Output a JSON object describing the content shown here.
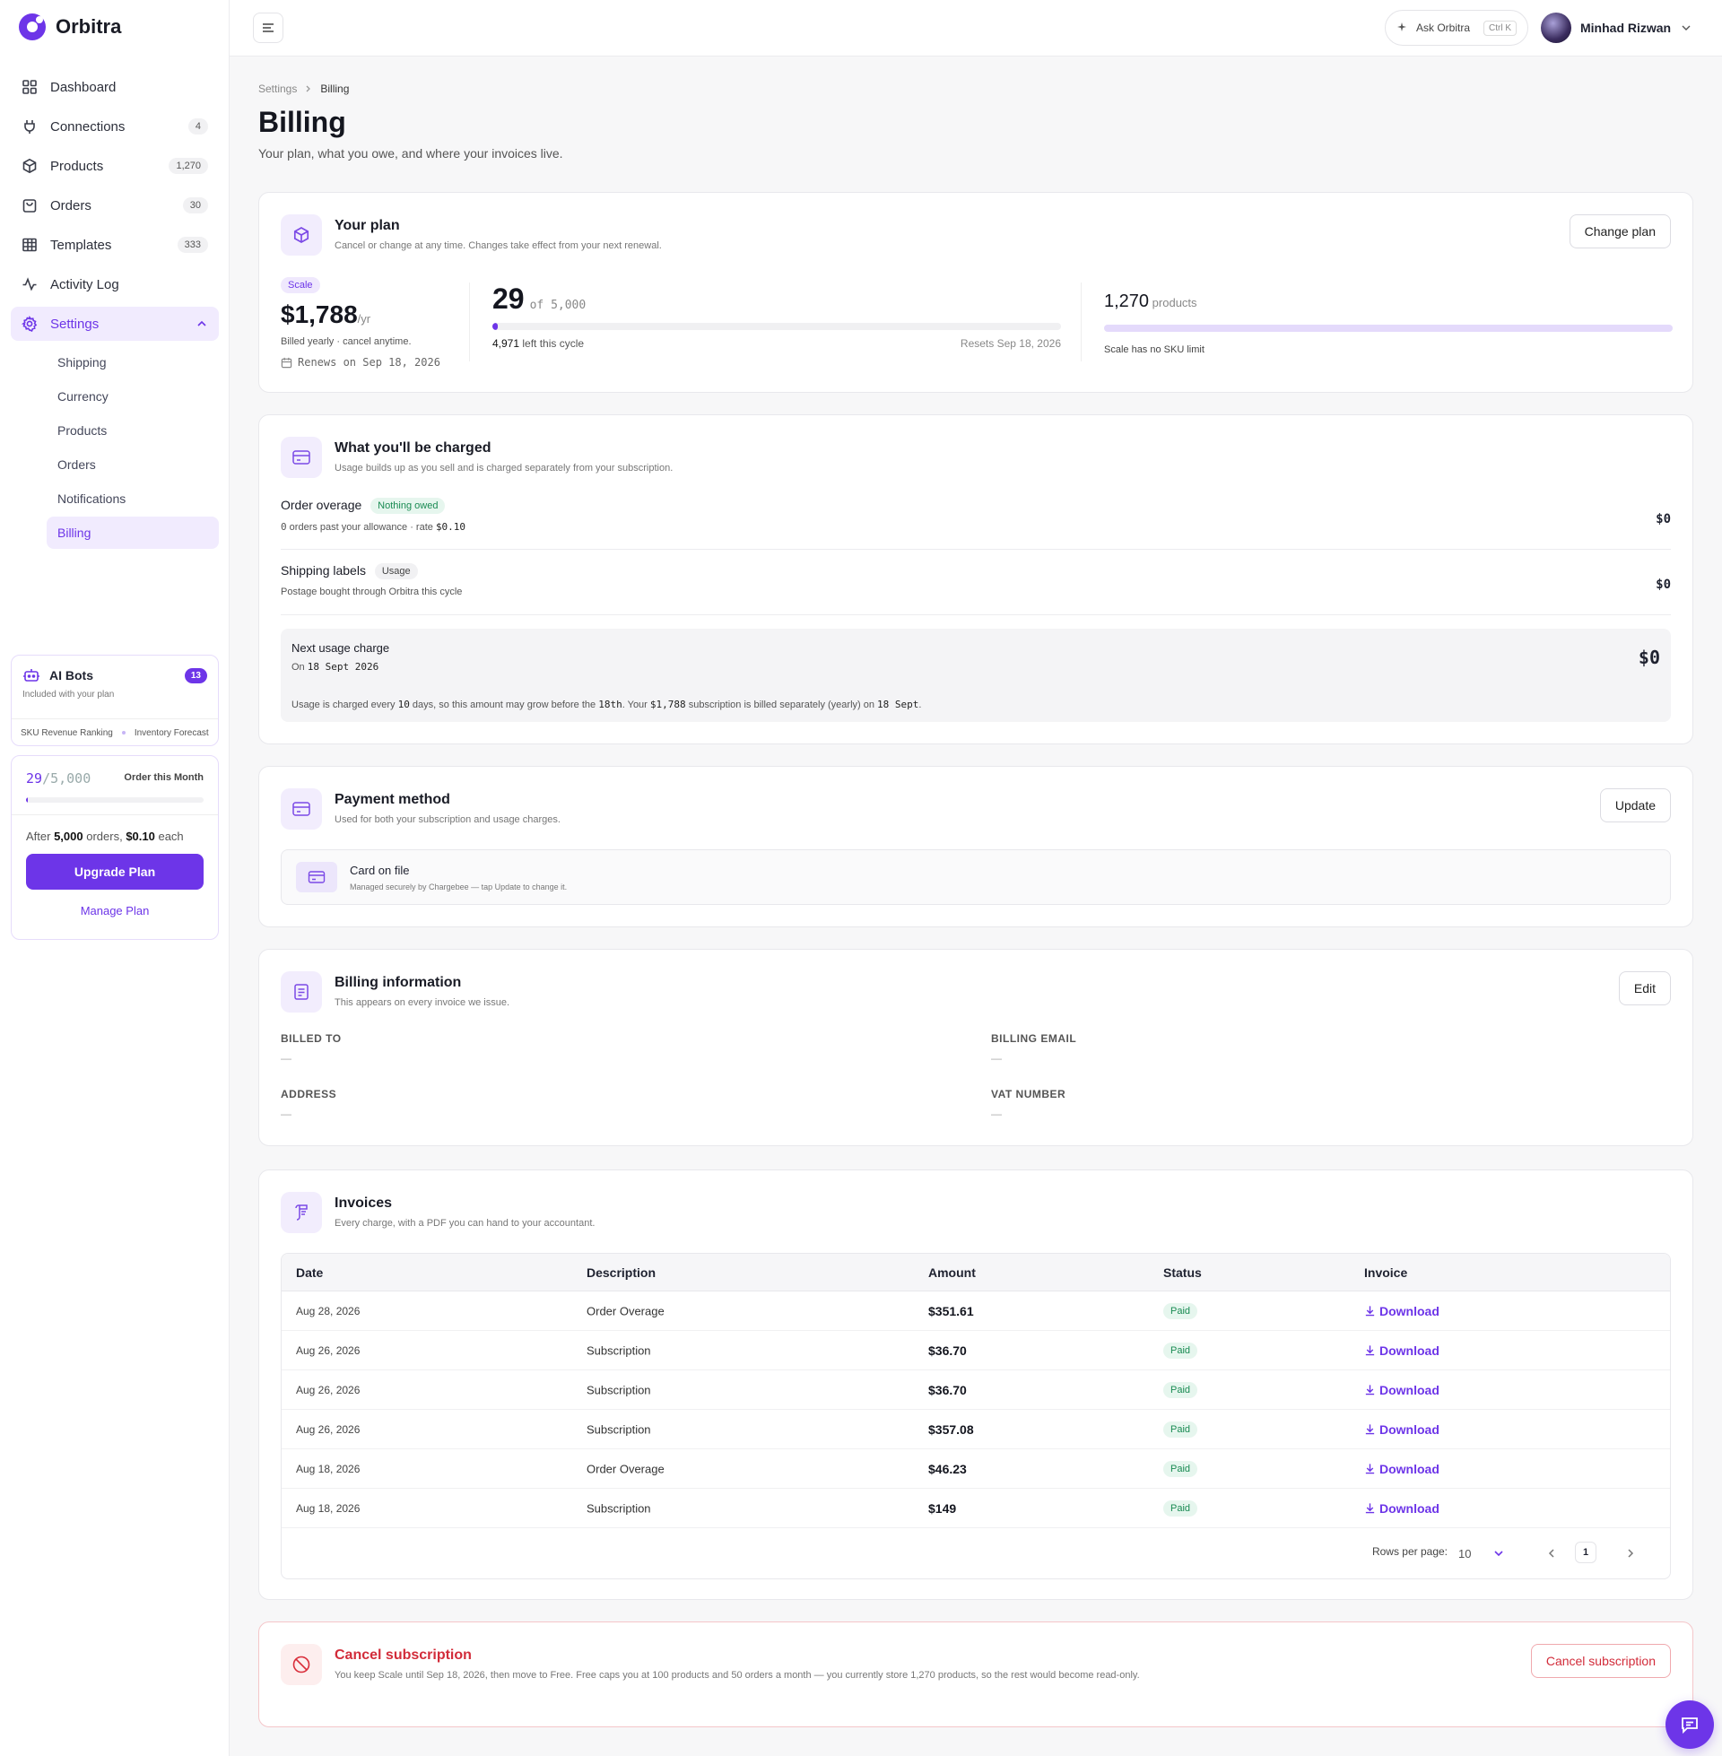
{
  "app": {
    "name": "Orbitra"
  },
  "sidebar": {
    "nav": [
      {
        "label": "Dashboard",
        "icon": "grid-icon",
        "count": ""
      },
      {
        "label": "Connections",
        "icon": "plug-icon",
        "count": "4"
      },
      {
        "label": "Products",
        "icon": "box-icon",
        "count": "1,270"
      },
      {
        "label": "Orders",
        "icon": "shopping-bag-icon",
        "count": "30"
      },
      {
        "label": "Templates",
        "icon": "table-icon",
        "count": "333"
      },
      {
        "label": "Activity Log",
        "icon": "activity-icon",
        "count": ""
      },
      {
        "label": "Settings",
        "icon": "gear-icon",
        "count": ""
      }
    ],
    "settings_sub": [
      "Shipping",
      "Currency",
      "Products",
      "Orders",
      "Notifications",
      "Billing"
    ],
    "active_sub": "Billing",
    "ai_bots": {
      "title": "AI Bots",
      "badge": "13",
      "subtitle": "Included with your plan",
      "tags": [
        "SKU Revenue Ranking",
        "Inventory Forecast"
      ]
    },
    "usage": {
      "used": "29",
      "total": "/5,000",
      "label": "Order this Month",
      "progress_fraction": 0.0058,
      "after_prefix": "After ",
      "after_orders": "5,000",
      "after_mid": " orders, ",
      "after_price": "$0.10",
      "after_suffix": " each",
      "upgrade_label": "Upgrade Plan",
      "manage_label": "Manage Plan"
    }
  },
  "topbar": {
    "ask_label": "Ask Orbitra",
    "ask_kbd": "Ctrl K",
    "user_name": "Minhad Rizwan"
  },
  "page": {
    "breadcrumb": [
      "Settings",
      "Billing"
    ],
    "title": "Billing",
    "subtitle": "Your plan, what you owe, and where your invoices live."
  },
  "plan": {
    "title": "Your plan",
    "desc": "Cancel or change at any time. Changes take effect from your next renewal.",
    "button": "Change plan",
    "tier": "Scale",
    "price": "$1,788",
    "per": "/yr",
    "note": "Billed yearly · cancel anytime.",
    "renews": "Renews on Sep 18, 2026",
    "orders_used": "29",
    "orders_of": "of 5,000",
    "orders_fraction": 0.0058,
    "orders_left_num": "4,971",
    "orders_left_txt": " left this cycle",
    "resets": "Resets Sep 18, 2026",
    "products_num": "1,270",
    "products_lbl": " products",
    "products_note": "Scale has no SKU limit"
  },
  "charges": {
    "title": "What you'll be charged",
    "desc": "Usage builds up as you sell and is charged separately from your subscription.",
    "overage": {
      "title": "Order overage",
      "badge": "Nothing owed",
      "count": "0",
      "sub_txt": " orders past your allowance · rate ",
      "rate": "$0.10",
      "amount": "$0"
    },
    "labels": {
      "title": "Shipping labels",
      "badge": "Usage",
      "sub": "Postage bought through Orbitra this cycle",
      "amount": "$0"
    },
    "next": {
      "title": "Next usage charge",
      "on": "On ",
      "date": "18 Sept 2026",
      "amount": "$0",
      "note_1": "Usage is charged every ",
      "note_days": "10",
      "note_2": " days, so this amount may grow before the ",
      "note_day": "18th",
      "note_3": ". Your ",
      "note_price": "$1,788",
      "note_4": " subscription is billed separately (yearly) on ",
      "note_date": "18 Sept",
      "note_5": "."
    }
  },
  "payment": {
    "title": "Payment method",
    "desc": "Used for both your subscription and usage charges.",
    "button": "Update",
    "card_title": "Card on file",
    "card_sub": "Managed securely by Chargebee — tap Update to change it."
  },
  "billing_info": {
    "title": "Billing information",
    "desc": "This appears on every invoice we issue.",
    "button": "Edit",
    "fields": [
      {
        "label": "BILLED TO",
        "value": "—"
      },
      {
        "label": "BILLING EMAIL",
        "value": "—"
      },
      {
        "label": "ADDRESS",
        "value": "—"
      },
      {
        "label": "VAT NUMBER",
        "value": "—"
      }
    ]
  },
  "invoices": {
    "title": "Invoices",
    "desc": "Every charge, with a PDF you can hand to your accountant.",
    "columns": [
      "Date",
      "Description",
      "Amount",
      "Status",
      "Invoice"
    ],
    "rows": [
      {
        "date": "Aug 28, 2026",
        "desc": "Order Overage",
        "amount": "$351.61",
        "status": "Paid",
        "action": "Download"
      },
      {
        "date": "Aug 26, 2026",
        "desc": "Subscription",
        "amount": "$36.70",
        "status": "Paid",
        "action": "Download"
      },
      {
        "date": "Aug 26, 2026",
        "desc": "Subscription",
        "amount": "$36.70",
        "status": "Paid",
        "action": "Download"
      },
      {
        "date": "Aug 26, 2026",
        "desc": "Subscription",
        "amount": "$357.08",
        "status": "Paid",
        "action": "Download"
      },
      {
        "date": "Aug 18, 2026",
        "desc": "Order Overage",
        "amount": "$46.23",
        "status": "Paid",
        "action": "Download"
      },
      {
        "date": "Aug 18, 2026",
        "desc": "Subscription",
        "amount": "$149",
        "status": "Paid",
        "action": "Download"
      }
    ],
    "rows_per_page_label": "Rows per page:",
    "rows_per_page": "10",
    "page": "1"
  },
  "cancel": {
    "title": "Cancel subscription",
    "desc": "You keep Scale until Sep 18, 2026, then move to Free. Free caps you at 100 products and 50 orders a month — you currently store 1,270 products, so the rest would become read-only.",
    "button": "Cancel subscription"
  },
  "colors": {
    "accent": "#6d35e8",
    "danger": "#d22c3a",
    "success": "#1a8b53"
  }
}
